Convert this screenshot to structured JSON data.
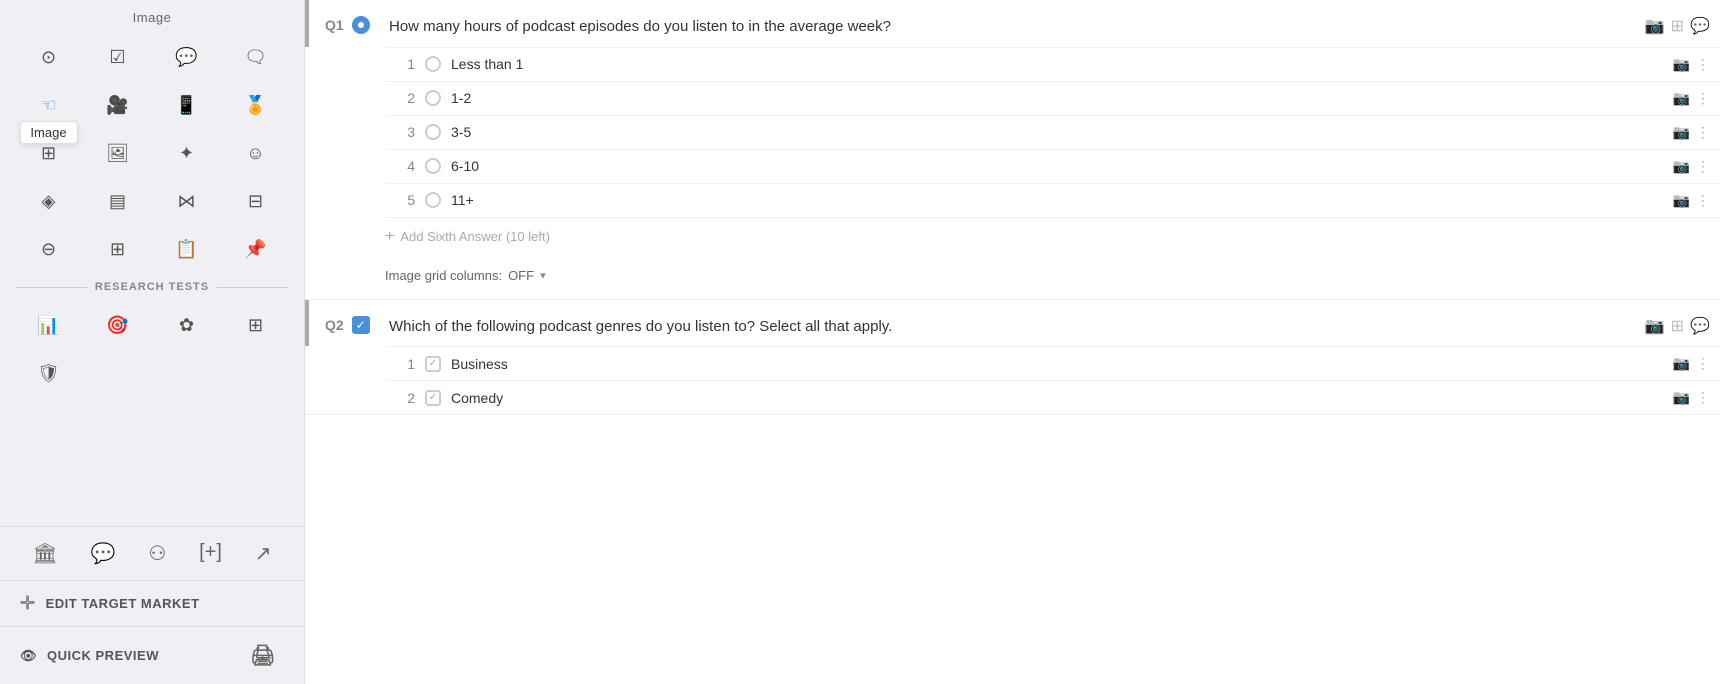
{
  "sidebar": {
    "title": "Image",
    "tooltip": "Image",
    "icon_rows": [
      [
        "radio",
        "checkbox",
        "speech-bubble-dots",
        "speech-bubble-lines"
      ],
      [
        "hand",
        "video-camera",
        "mobile",
        "award"
      ],
      [
        "grid",
        "image-frame",
        "star",
        "smiley"
      ],
      [
        "diamond",
        "list",
        "bow-tie",
        "strikethrough"
      ],
      [
        "subtract-circle",
        "grid-plus",
        "clipboard",
        "pin"
      ]
    ],
    "research_tests_label": "RESEARCH TESTS",
    "research_icons": [
      "bar-chart",
      "target",
      "flower",
      "table",
      "shield"
    ],
    "bottom_icons": [
      "bank",
      "chat-bubbles",
      "usb",
      "bracket-plus",
      "share"
    ],
    "edit_target_label": "EDIT TARGET MARKET",
    "quick_preview_label": "QUICK PREVIEW"
  },
  "questions": [
    {
      "id": "Q1",
      "type": "radio",
      "text": "How many hours of podcast episodes do you listen to in the average week?",
      "answers": [
        {
          "num": 1,
          "text": "Less than 1"
        },
        {
          "num": 2,
          "text": "1-2"
        },
        {
          "num": 3,
          "text": "3-5"
        },
        {
          "num": 4,
          "text": "6-10"
        },
        {
          "num": 5,
          "text": "11+"
        }
      ],
      "add_answer_label": "Add Sixth Answer (10 left)",
      "image_grid_label": "Image grid columns:",
      "image_grid_value": "OFF"
    },
    {
      "id": "Q2",
      "type": "checkbox",
      "text": "Which of the following podcast genres do you listen to? Select all that apply.",
      "answers": [
        {
          "num": 1,
          "text": "Business"
        },
        {
          "num": 2,
          "text": "Comedy"
        }
      ]
    }
  ]
}
